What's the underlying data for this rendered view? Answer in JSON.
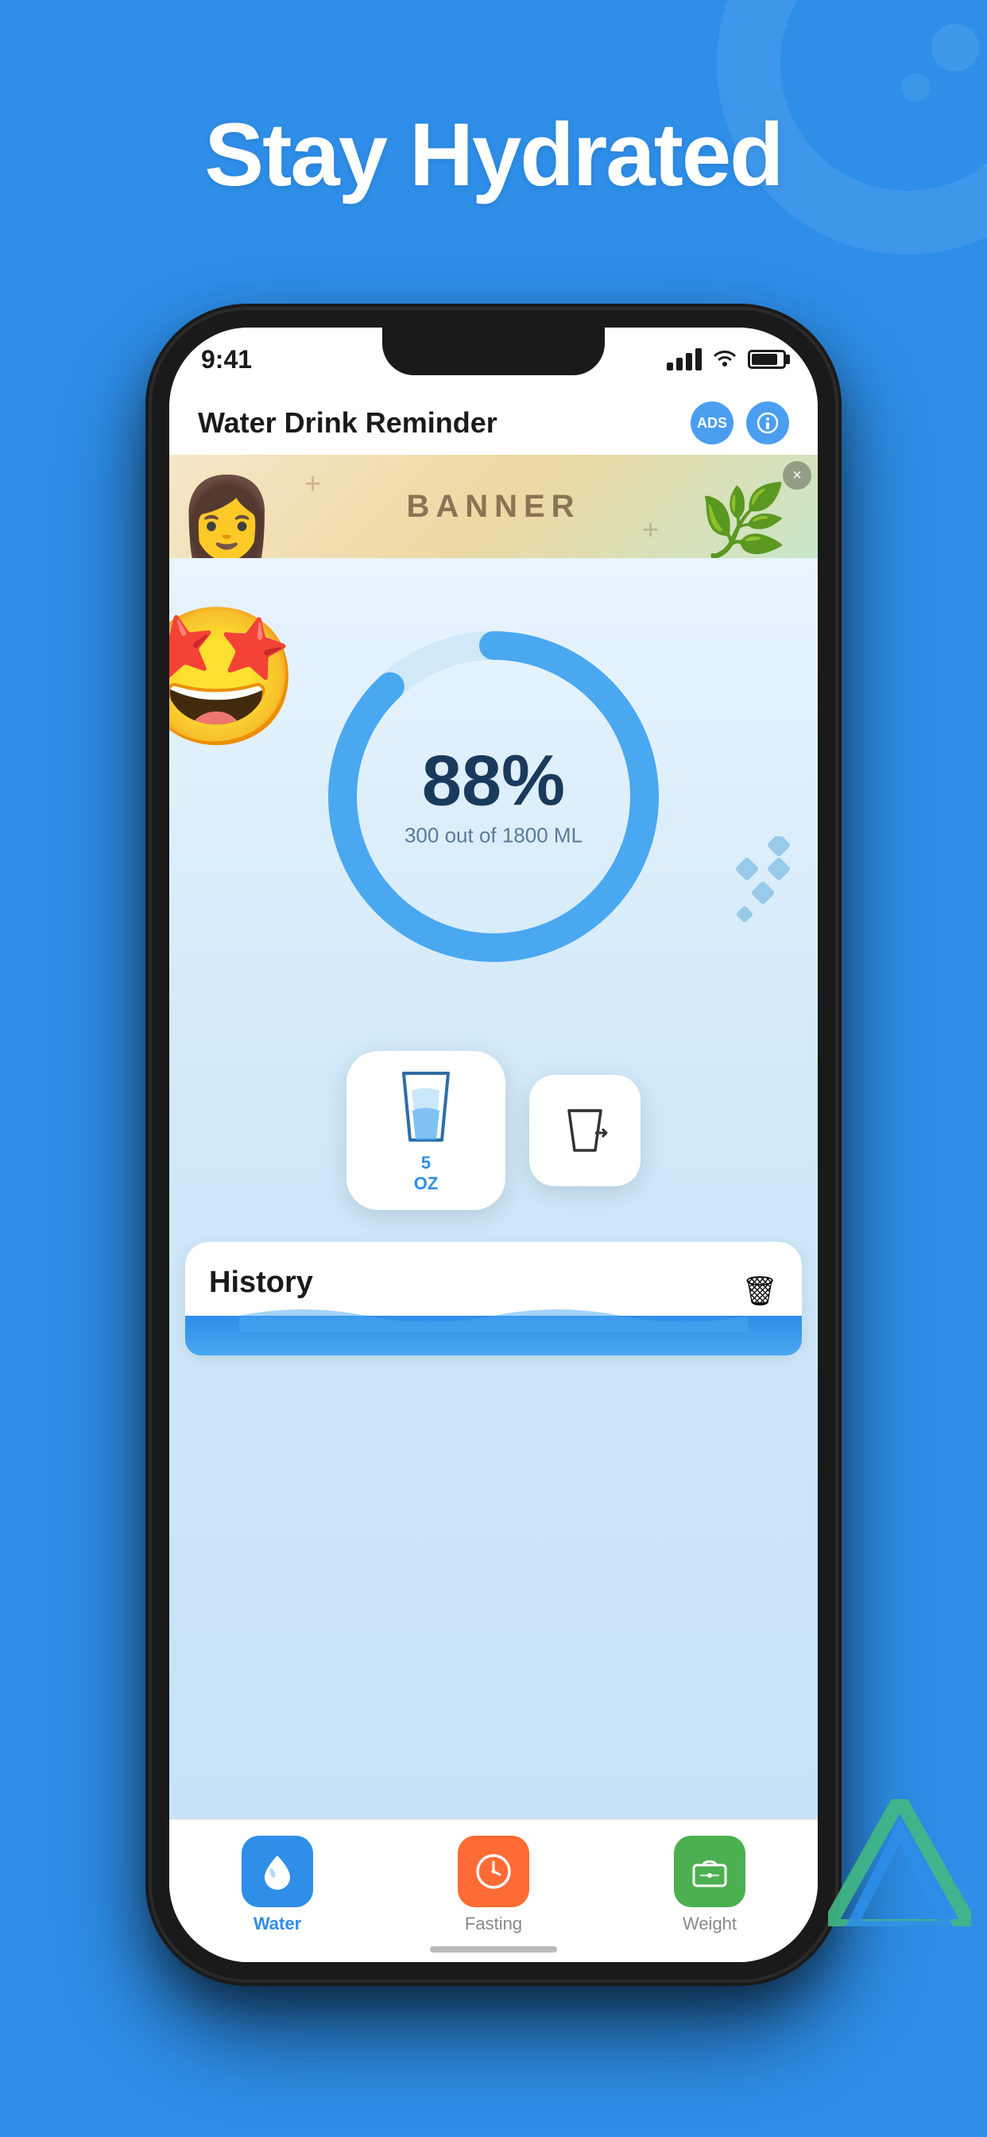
{
  "page": {
    "background_color": "#2E8EE8",
    "title": "Stay Hydrated"
  },
  "status_bar": {
    "time": "9:41",
    "signal_bars": [
      1,
      2,
      3,
      4
    ],
    "wifi": true,
    "battery_percent": 85
  },
  "app_header": {
    "title": "Water Drink Reminder",
    "ads_button": "ADS",
    "info_button": "○"
  },
  "banner": {
    "text": "BANNER",
    "close": "×"
  },
  "progress": {
    "percent": "88%",
    "current": 300,
    "total": 1800,
    "unit": "ML",
    "label": "300 out of 1800 ML",
    "stroke_color": "#4AA8F0",
    "track_color": "#D0E8F8"
  },
  "action_primary": {
    "amount": "5",
    "unit": "OZ"
  },
  "history": {
    "title": "History",
    "trash_icon": "🗑"
  },
  "tab_bar": {
    "tabs": [
      {
        "id": "water",
        "label": "Water",
        "active": true,
        "icon_color": "#2E8EE8"
      },
      {
        "id": "fasting",
        "label": "Fasting",
        "active": false,
        "icon_color": "#FF6B35"
      },
      {
        "id": "weight",
        "label": "Weight",
        "active": false,
        "icon_color": "#4CAF50"
      }
    ]
  },
  "decorations": {
    "emoji": "🤩",
    "diamonds_color": "#5BA8D8"
  }
}
